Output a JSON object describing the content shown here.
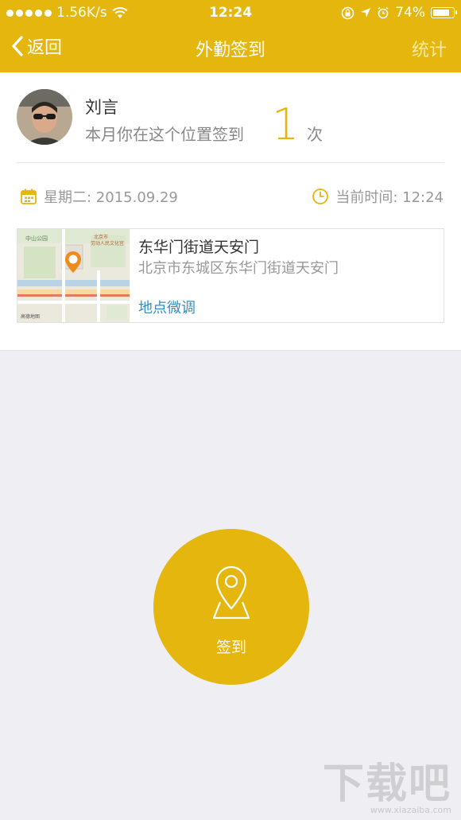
{
  "status_bar": {
    "network": "1.56K/s",
    "time": "12:24",
    "battery": "74%"
  },
  "nav": {
    "back_label": "返回",
    "title": "外勤签到",
    "stats_label": "统计"
  },
  "user": {
    "name": "刘言",
    "count_prefix": "本月你在这个位置签到",
    "count": "1",
    "count_unit": "次"
  },
  "info": {
    "date": "星期二: 2015.09.29",
    "current_time": "当前时间: 12:24"
  },
  "location": {
    "title": "东华门街道天安门",
    "address": "北京市东城区东华门街道天安门",
    "adjust_label": "地点微调"
  },
  "checkin": {
    "label": "签到"
  },
  "colors": {
    "accent": "#e5b60d",
    "link": "#2f8fc7",
    "background": "#efeef3"
  }
}
